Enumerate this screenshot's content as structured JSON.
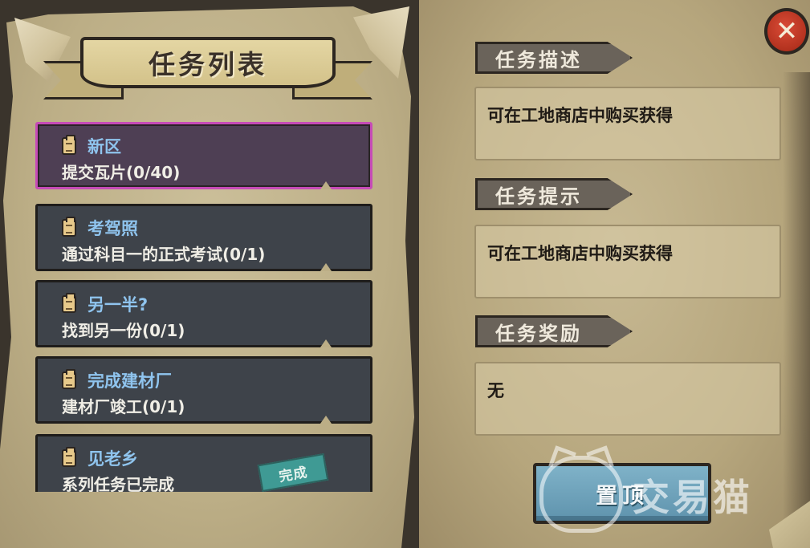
{
  "quest_panel": {
    "title": "任务列表",
    "quests": [
      {
        "name": "新区",
        "desc": "提交瓦片(0/40)",
        "selected": true
      },
      {
        "name": "考驾照",
        "desc": "通过科目一的正式考试(0/1)",
        "selected": false
      },
      {
        "name": "另一半?",
        "desc": "找到另一份(0/1)",
        "selected": false
      },
      {
        "name": "完成建材厂",
        "desc": "建材厂竣工(0/1)",
        "selected": false
      },
      {
        "name": "见老乡",
        "desc": "系列任务已完成",
        "selected": false,
        "stamp": "完成"
      }
    ]
  },
  "detail_panel": {
    "description_label": "任务描述",
    "description_text": "可在工地商店中购买获得",
    "hint_label": "任务提示",
    "hint_text": "可在工地商店中购买获得",
    "reward_label": "任务奖励",
    "reward_text": "无",
    "pin_button_label": "置顶"
  },
  "watermark": {
    "text": "交易猫"
  },
  "colors": {
    "selected_border": "#c64bb7",
    "quest_name": "#8fc4ee",
    "close_button": "#c23a25",
    "pin_button": "#6fa3bd"
  },
  "icons": {
    "quest_icon": "clipboard-icon",
    "close_icon": "close-icon"
  }
}
